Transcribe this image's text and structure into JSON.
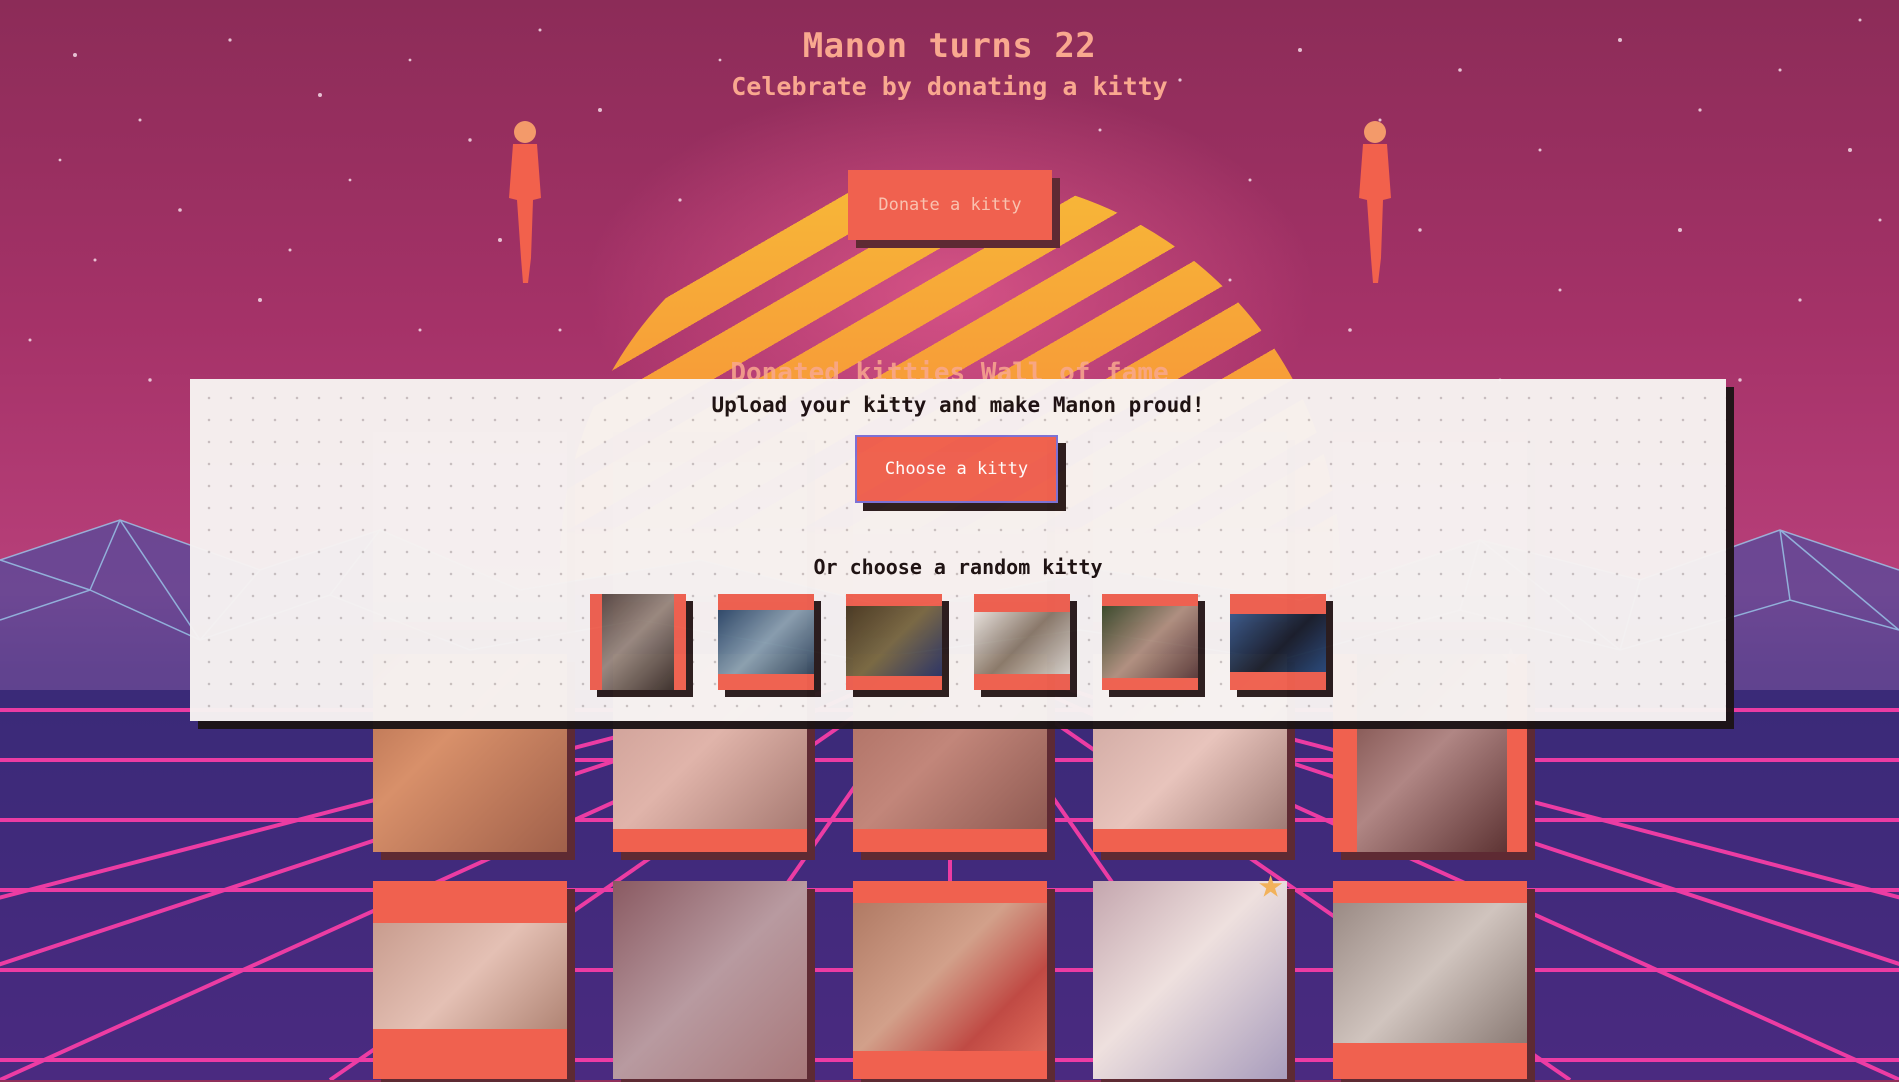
{
  "header": {
    "title": "Manon turns 22",
    "subtitle": "Celebrate by donating a kitty"
  },
  "donate": {
    "label": "Donate a kitty"
  },
  "wall": {
    "title": "Donated kitties Wall of fame"
  },
  "modal": {
    "title": "Upload your kitty and make Manon proud!",
    "choose_label": "Choose a kitty",
    "or_text": "Or choose a random kitty"
  },
  "colors": {
    "accent": "#f0614f",
    "shadow": "#5e2a33",
    "title_text": "#f9a88f",
    "sun_top": "#f7b838",
    "grid_line": "#ff3fa8"
  },
  "icons": {
    "star": "star-icon",
    "figure": "dancing-girl-figure"
  }
}
